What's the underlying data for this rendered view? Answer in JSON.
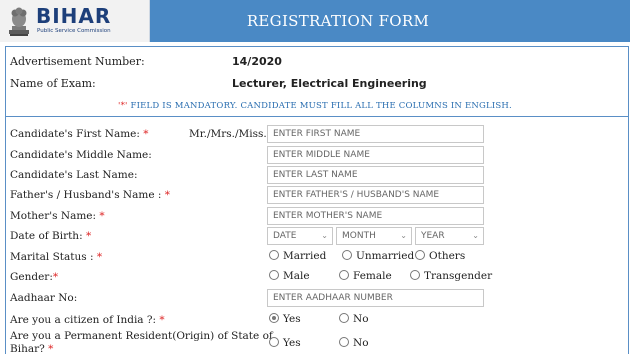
{
  "header": {
    "org_name": "BIHAR",
    "org_sub": "Public Service Commission",
    "form_title": "REGISTRATION FORM"
  },
  "info": {
    "advertisement_label": "Advertisement Number:",
    "advertisement_value": "14/2020",
    "exam_label": "Name of Exam:",
    "exam_value": "Lecturer, Electrical Engineering"
  },
  "notice": {
    "star": "'*'",
    "text": " FIELD IS MANDATORY. CANDIDATE MUST FILL ALL THE COLUMNS IN ENGLISH."
  },
  "fields": {
    "first_name": {
      "label": "Candidate's First Name:",
      "required": "*",
      "prefix": "Mr./Mrs./Miss.",
      "placeholder": "ENTER FIRST NAME"
    },
    "middle_name": {
      "label": "Candidate's Middle Name:",
      "placeholder": "ENTER MIDDLE NAME"
    },
    "last_name": {
      "label": "Candidate's Last Name:",
      "placeholder": "ENTER LAST NAME"
    },
    "father_name": {
      "label": "Father's / Husband's Name :",
      "required": "*",
      "placeholder": "ENTER FATHER'S / HUSBAND'S NAME"
    },
    "mother_name": {
      "label": "Mother's Name:",
      "required": "*",
      "placeholder": "ENTER MOTHER'S NAME"
    },
    "dob": {
      "label": "Date of Birth:",
      "required": "*",
      "date": "DATE",
      "month": "MONTH",
      "year": "YEAR"
    },
    "marital": {
      "label": "Marital Status :",
      "required": "*",
      "options": [
        "Married",
        "Unmarried",
        "Others"
      ]
    },
    "gender": {
      "label": "Gender:",
      "required": "*",
      "options": [
        "Male",
        "Female",
        "Transgender"
      ]
    },
    "aadhaar": {
      "label": "Aadhaar No:",
      "placeholder": "ENTER AADHAAR NUMBER"
    },
    "citizen": {
      "label": "Are you a citizen of India ?:",
      "required": "*",
      "options": [
        "Yes",
        "No"
      ],
      "selected": "Yes"
    },
    "resident": {
      "label_line1": "Are you a Permanent Resident(Origin) of State of",
      "label_line2": "Bihar?",
      "required": "*",
      "options": [
        "Yes",
        "No"
      ]
    }
  },
  "colors": {
    "header_bg": "#4a89c5",
    "required": "#dd2222",
    "border": "#5a8fc6"
  }
}
